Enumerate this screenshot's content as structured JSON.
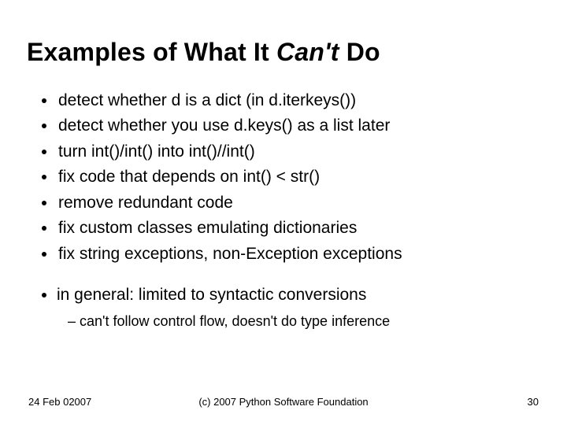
{
  "title_pre": "Examples of What It ",
  "title_em": "Can't",
  "title_post": " Do",
  "bullets": [
    "detect whether d is a dict (in d.iterkeys())",
    "detect whether you use d.keys() as a list later",
    "turn int()/int() into int()//int()",
    "fix code that depends on int() < str()",
    "remove redundant code",
    "fix custom classes emulating dictionaries",
    "fix string exceptions, non-Exception exceptions"
  ],
  "summary": "in general: limited to syntactic conversions",
  "summary_sub": "can't follow control flow, doesn't do type inference",
  "footer": {
    "date": "24 Feb 02007",
    "copyright": "(c) 2007 Python Software Foundation",
    "page": "30"
  }
}
